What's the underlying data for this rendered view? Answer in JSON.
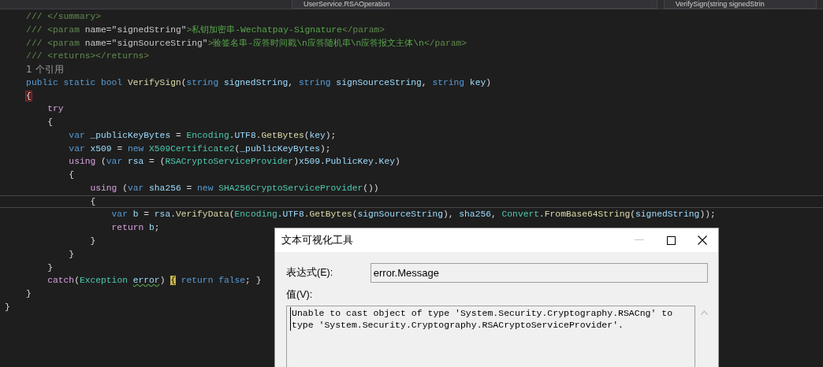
{
  "nav_bar": {
    "class_dropdown": "UserService.RSAOperation",
    "member_dropdown": "VerifySign(string signedStrin"
  },
  "code_lines": [
    {
      "children": [
        {
          "tokens": [
            {
              "text": "/// ",
              "kind": "doc"
            },
            {
              "text": "</summary>",
              "kind": "doc"
            }
          ]
        },
        {
          "tokens": [
            {
              "text": "/// ",
              "kind": "doc"
            },
            {
              "text": "<param ",
              "kind": "doc"
            },
            {
              "text": "name=",
              "kind": "doc-attr"
            },
            {
              "text": "\"signedString\"",
              "kind": "doc-attr"
            },
            {
              "text": ">",
              "kind": "doc"
            },
            {
              "text": "私钥加密串-Wechatpay-Signature",
              "kind": "doc-text"
            },
            {
              "text": "</param>",
              "kind": "doc"
            }
          ]
        },
        {
          "tokens": [
            {
              "text": "/// ",
              "kind": "doc"
            },
            {
              "text": "<param ",
              "kind": "doc"
            },
            {
              "text": "name=",
              "kind": "doc-attr"
            },
            {
              "text": "\"signSourceString\"",
              "kind": "doc-attr"
            },
            {
              "text": ">",
              "kind": "doc"
            },
            {
              "text": "验签名串-应答时间戳\\n应答随机串\\n应答报文主体\\n",
              "kind": "doc-text"
            },
            {
              "text": "</param>",
              "kind": "doc"
            }
          ]
        },
        {
          "tokens": [
            {
              "text": "/// ",
              "kind": "doc"
            },
            {
              "text": "<returns></returns>",
              "kind": "doc"
            }
          ]
        },
        {
          "codelens": "1 个引用"
        },
        {
          "tokens": [
            {
              "text": "public static bool ",
              "kind": "keyword"
            },
            {
              "text": "VerifySign",
              "kind": "method"
            },
            {
              "text": "(",
              "kind": "plain"
            },
            {
              "text": "string ",
              "kind": "keyword"
            },
            {
              "text": "signedString",
              "kind": "param"
            },
            {
              "text": ", ",
              "kind": "plain"
            },
            {
              "text": "string ",
              "kind": "keyword"
            },
            {
              "text": "signSourceString",
              "kind": "param"
            },
            {
              "text": ", ",
              "kind": "plain"
            },
            {
              "text": "string ",
              "kind": "keyword"
            },
            {
              "text": "key",
              "kind": "param"
            },
            {
              "text": ")",
              "kind": "plain"
            }
          ]
        },
        {
          "tokens": [
            {
              "text": "{",
              "kind": "brace-cursor"
            }
          ]
        },
        {
          "children": [
            {
              "tokens": [
                {
                  "text": "try",
                  "kind": "control"
                }
              ]
            },
            {
              "tokens": [
                {
                  "text": "{",
                  "kind": "plain"
                }
              ]
            },
            {
              "children": [
                {
                  "tokens": [
                    {
                      "text": "var ",
                      "kind": "keyword"
                    },
                    {
                      "text": "_publicKeyBytes",
                      "kind": "param"
                    },
                    {
                      "text": " = ",
                      "kind": "plain"
                    },
                    {
                      "text": "Encoding",
                      "kind": "type"
                    },
                    {
                      "text": ".",
                      "kind": "plain"
                    },
                    {
                      "text": "UTF8",
                      "kind": "param"
                    },
                    {
                      "text": ".",
                      "kind": "plain"
                    },
                    {
                      "text": "GetBytes",
                      "kind": "method"
                    },
                    {
                      "text": "(",
                      "kind": "plain"
                    },
                    {
                      "text": "key",
                      "kind": "param"
                    },
                    {
                      "text": ");",
                      "kind": "plain"
                    }
                  ]
                },
                {
                  "tokens": [
                    {
                      "text": "var ",
                      "kind": "keyword"
                    },
                    {
                      "text": "x509",
                      "kind": "param"
                    },
                    {
                      "text": " = ",
                      "kind": "plain"
                    },
                    {
                      "text": "new ",
                      "kind": "keyword"
                    },
                    {
                      "text": "X509Certificate2",
                      "kind": "type"
                    },
                    {
                      "text": "(",
                      "kind": "plain"
                    },
                    {
                      "text": "_publicKeyBytes",
                      "kind": "param"
                    },
                    {
                      "text": ");",
                      "kind": "plain"
                    }
                  ]
                },
                {
                  "tokens": [
                    {
                      "text": "using",
                      "kind": "control"
                    },
                    {
                      "text": " (",
                      "kind": "plain"
                    },
                    {
                      "text": "var ",
                      "kind": "keyword"
                    },
                    {
                      "text": "rsa",
                      "kind": "param"
                    },
                    {
                      "text": " = (",
                      "kind": "plain"
                    },
                    {
                      "text": "RSACryptoServiceProvider",
                      "kind": "type"
                    },
                    {
                      "text": ")",
                      "kind": "plain"
                    },
                    {
                      "text": "x509",
                      "kind": "param"
                    },
                    {
                      "text": ".",
                      "kind": "plain"
                    },
                    {
                      "text": "PublicKey",
                      "kind": "param"
                    },
                    {
                      "text": ".",
                      "kind": "plain"
                    },
                    {
                      "text": "Key",
                      "kind": "param"
                    },
                    {
                      "text": ")",
                      "kind": "plain"
                    }
                  ]
                },
                {
                  "tokens": [
                    {
                      "text": "{",
                      "kind": "plain"
                    }
                  ]
                },
                {
                  "children": [
                    {
                      "tokens": [
                        {
                          "text": "using",
                          "kind": "control"
                        },
                        {
                          "text": " (",
                          "kind": "plain"
                        },
                        {
                          "text": "var ",
                          "kind": "keyword"
                        },
                        {
                          "text": "sha256",
                          "kind": "param"
                        },
                        {
                          "text": " = ",
                          "kind": "plain"
                        },
                        {
                          "text": "new ",
                          "kind": "keyword"
                        },
                        {
                          "text": "SHA256CryptoServiceProvider",
                          "kind": "type"
                        },
                        {
                          "text": "())",
                          "kind": "plain"
                        }
                      ]
                    },
                    {
                      "current": true,
                      "tokens": [
                        {
                          "text": "{",
                          "kind": "plain"
                        }
                      ]
                    },
                    {
                      "children": [
                        {
                          "tokens": [
                            {
                              "text": "var ",
                              "kind": "keyword"
                            },
                            {
                              "text": "b",
                              "kind": "param"
                            },
                            {
                              "text": " = ",
                              "kind": "plain"
                            },
                            {
                              "text": "rsa",
                              "kind": "param"
                            },
                            {
                              "text": ".",
                              "kind": "plain"
                            },
                            {
                              "text": "VerifyData",
                              "kind": "method"
                            },
                            {
                              "text": "(",
                              "kind": "plain"
                            },
                            {
                              "text": "Encoding",
                              "kind": "type"
                            },
                            {
                              "text": ".",
                              "kind": "plain"
                            },
                            {
                              "text": "UTF8",
                              "kind": "param"
                            },
                            {
                              "text": ".",
                              "kind": "plain"
                            },
                            {
                              "text": "GetBytes",
                              "kind": "method"
                            },
                            {
                              "text": "(",
                              "kind": "plain"
                            },
                            {
                              "text": "signSourceString",
                              "kind": "param"
                            },
                            {
                              "text": "), ",
                              "kind": "plain"
                            },
                            {
                              "text": "sha256",
                              "kind": "param"
                            },
                            {
                              "text": ", ",
                              "kind": "plain"
                            },
                            {
                              "text": "Convert",
                              "kind": "type"
                            },
                            {
                              "text": ".",
                              "kind": "plain"
                            },
                            {
                              "text": "FromBase64String",
                              "kind": "method"
                            },
                            {
                              "text": "(",
                              "kind": "plain"
                            },
                            {
                              "text": "signedString",
                              "kind": "param"
                            },
                            {
                              "text": "));",
                              "kind": "plain"
                            }
                          ]
                        },
                        {
                          "tokens": [
                            {
                              "text": "return ",
                              "kind": "control"
                            },
                            {
                              "text": "b",
                              "kind": "param"
                            },
                            {
                              "text": ";",
                              "kind": "plain"
                            }
                          ]
                        }
                      ]
                    },
                    {
                      "tokens": [
                        {
                          "text": "}",
                          "kind": "plain"
                        }
                      ]
                    }
                  ]
                },
                {
                  "tokens": [
                    {
                      "text": "}",
                      "kind": "plain"
                    }
                  ]
                }
              ]
            },
            {
              "tokens": [
                {
                  "text": "}",
                  "kind": "plain"
                }
              ]
            },
            {
              "tokens": [
                {
                  "text": "catch",
                  "kind": "control"
                },
                {
                  "text": "(",
                  "kind": "plain"
                },
                {
                  "text": "Exception ",
                  "kind": "type"
                },
                {
                  "text": "error",
                  "kind": "warn"
                },
                {
                  "text": ") ",
                  "kind": "plain"
                },
                {
                  "text": "{",
                  "kind": "brace-match"
                },
                {
                  "text": " return false",
                  "kind": "keyword"
                },
                {
                  "text": "; }",
                  "kind": "plain"
                }
              ]
            }
          ]
        },
        {
          "tokens": [
            {
              "text": "}",
              "kind": "plain"
            }
          ]
        }
      ]
    },
    {
      "tokens": [
        {
          "text": "}",
          "kind": "plain"
        }
      ]
    }
  ],
  "dialog": {
    "title": "文本可视化工具",
    "expression_label": "表达式(E):",
    "expression": "error.Message",
    "value_label": "值(V):",
    "value": "Unable to cast object of type 'System.Security.Cryptography.RSACng' to type 'System.Security.Cryptography.RSACryptoServiceProvider'."
  }
}
